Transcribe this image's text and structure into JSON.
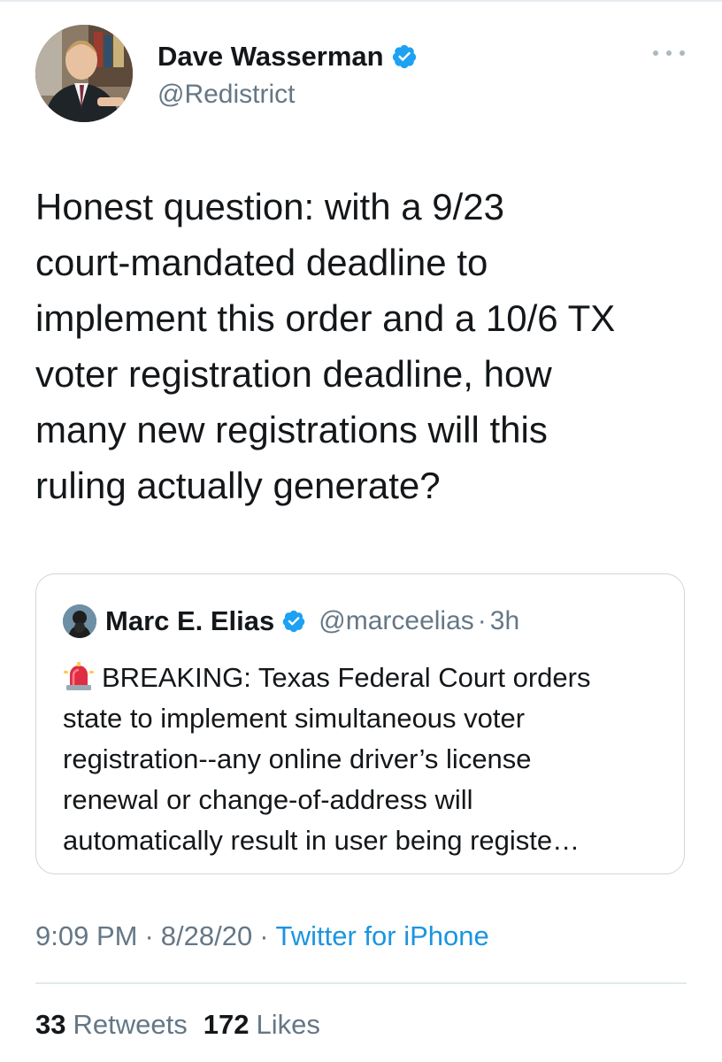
{
  "tweet": {
    "author": {
      "name": "Dave Wasserman",
      "handle": "@Redistrict",
      "verified": true
    },
    "text_lines": [
      "Honest question: with a 9/23",
      "court-mandated deadline to",
      "implement this order and a 10/6 TX",
      "voter registration deadline, how",
      "many new registrations will this",
      "ruling actually generate?"
    ],
    "quoted": {
      "name": "Marc E. Elias",
      "handle": "@marceelias",
      "separator": "·",
      "time": "3h",
      "verified": true,
      "icon": "siren-emoji",
      "text_lines": [
        "BREAKING: Texas Federal Court orders",
        "state to implement simultaneous voter",
        "registration--any online driver’s license",
        "renewal or change-of-address will",
        "automatically result in user being registe…"
      ]
    },
    "meta": {
      "time": "9:09 PM",
      "separator": "·",
      "date": "8/28/20",
      "source": "Twitter for iPhone"
    },
    "stats": {
      "retweets_count": "33",
      "retweets_label": "Retweets",
      "likes_count": "172",
      "likes_label": "Likes"
    }
  },
  "colors": {
    "verified_blue": "#1da1f2",
    "secondary_text": "#657786",
    "link_blue": "#1b95e0",
    "border": "#ccd6dd"
  }
}
